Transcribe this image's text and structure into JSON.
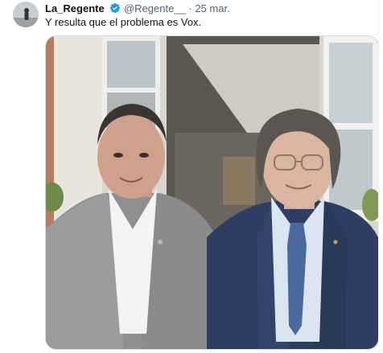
{
  "tweet": {
    "display_name": "La_Regente",
    "handle": "@Regente__",
    "separator": "·",
    "date": "25 mar.",
    "text": "Y resulta que el problema es Vox.",
    "verified": true,
    "media_icon": "photo",
    "avatar_icon": "avatar",
    "accent_color": "#1d9bf0"
  }
}
